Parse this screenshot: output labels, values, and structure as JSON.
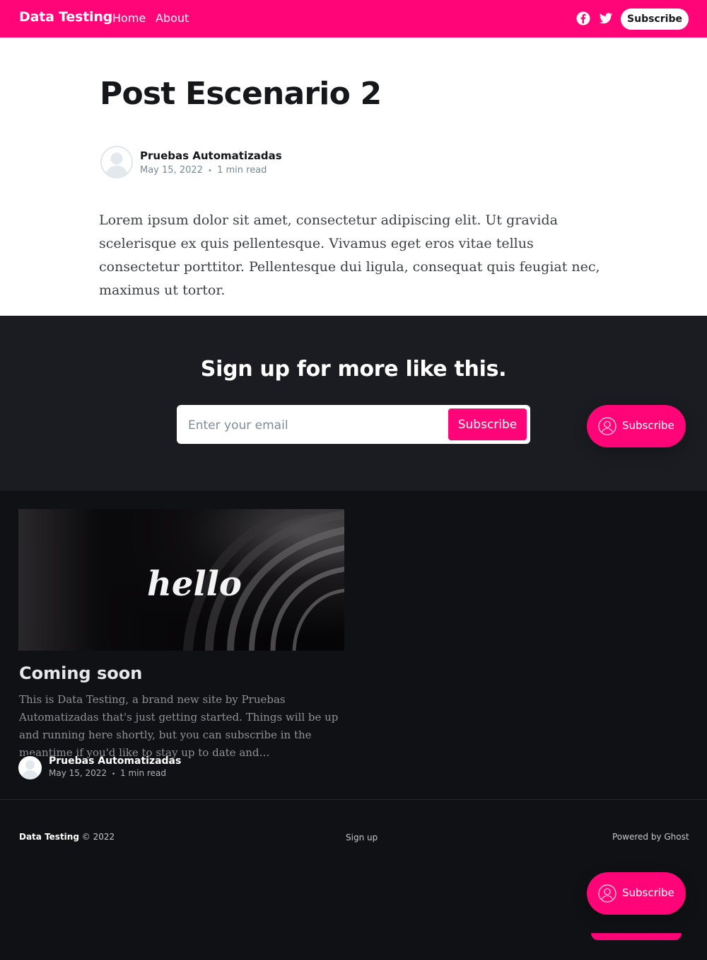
{
  "nav": {
    "brand": "Data Testing",
    "links": [
      "Home",
      "About"
    ],
    "subscribe_label": "Subscribe"
  },
  "article": {
    "title": "Post Escenario 2",
    "author": "Pruebas Automatizadas",
    "date": "May 15, 2022",
    "separator": "•",
    "read_time": "1 min read",
    "body": "Lorem ipsum dolor sit amet, consectetur adipiscing elit. Ut gravida scelerisque ex quis pellentesque. Vivamus eget eros vitae tellus consectetur porttitor. Pellentesque dui ligula, consequat quis feugiat nec, maximus ut tortor."
  },
  "signup": {
    "title": "Sign up for more like this.",
    "email_placeholder": "Enter your email",
    "button_label": "Subscribe"
  },
  "portal": {
    "label": "Subscribe"
  },
  "feed": {
    "card": {
      "image_text": "hello",
      "title": "Coming soon",
      "excerpt": "This is Data Testing, a brand new site by Pruebas Automatizadas that's just getting started. Things will be up and running here shortly, but you can subscribe in the meantime if you'd like to stay up to date and…",
      "author": "Pruebas Automatizadas",
      "date": "May 15, 2022",
      "separator": "•",
      "read_time": "1 min read"
    }
  },
  "footer": {
    "brand": "Data Testing",
    "copyright": "© 2022",
    "signup_label": "Sign up",
    "powered_by": "Powered by Ghost"
  },
  "colors": {
    "accent": "#ff0578",
    "dark": "#15171a",
    "signup_bg": "#1b1c21",
    "feed_bg": "#0f1114"
  },
  "icons": [
    "facebook-icon",
    "twitter-icon",
    "avatar-placeholder-icon",
    "member-icon"
  ]
}
